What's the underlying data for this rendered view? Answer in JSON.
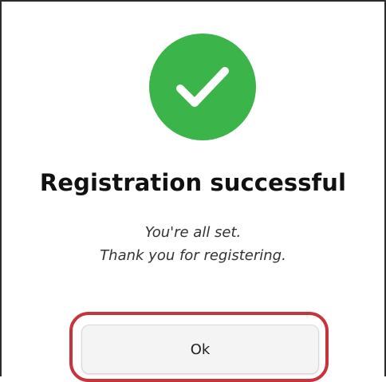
{
  "dialog": {
    "icon": "checkmark-icon",
    "title": "Registration successful",
    "message_lines": [
      "You're all set.",
      "Thank you for registering."
    ],
    "ok_label": "Ok"
  },
  "colors": {
    "success": "#3bb44a",
    "highlight": "#c8343c",
    "button_bg": "#f4f4f4",
    "border": "#2b2b2b"
  }
}
